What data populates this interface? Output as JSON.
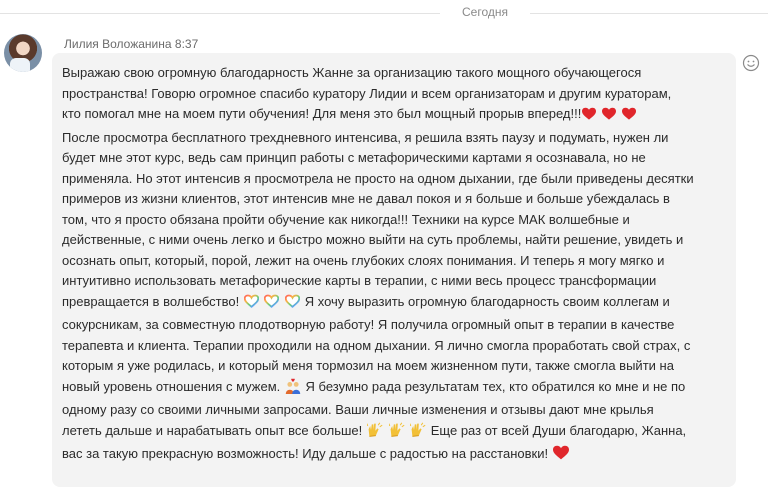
{
  "date_separator": "Сегодня",
  "message": {
    "sender": "Лилия Воложанина",
    "time": "8:37",
    "lines": [
      "Выражаю свою огромную благодарность Жанне за организацию такого мощного обучающегося",
      "пространства! Говорю огромное спасибо куратору Лидии и всем организаторам и другим кураторам,",
      "кто помогал мне на моем пути обучения! Для меня это был мощный прорыв вперед!!!",
      "После просмотра бесплатного трехдневного интенсива,  я решила взять паузу и подумать, нужен ли",
      "будет мне этот курс, ведь сам принцип работы с метафорическими картами я осознавала, но не",
      "применяла. Но этот интенсив я просмотрела не просто на одном дыхании, где были приведены десятки",
      "примеров из жизни клиентов, этот интенсив мне не давал покоя и я больше и больше убеждалась в",
      "том, что я просто обязана пройти обучение как никогда!!! Техники на курсе МАК волшебные и",
      "действенные, с ними очень легко и быстро можно выйти на суть проблемы, найти решение, увидеть и",
      "осознать опыт, который, порой, лежит на очень глубоких слоях понимания. И теперь я могу мягко и",
      "интуитивно использовать метафорические карты в терапии, с ними весь процесс трансформации",
      "превращается в волшебство!",
      "Я хочу  выразить огромную благодарность своим коллегам и",
      "сокурсникам, за совместную плодотворную работу! Я получила огромный опыт в терапии в качестве",
      "терапевта и клиента. Терапии проходили на одном дыхании. Я лично смогла проработать свой страх, с",
      "которым я уже родилась, и который меня тормозил на моем жизненном пути, также смогла выйти на",
      "новый уровень отношения с мужем.",
      "Я безумно рада результатам тех, кто обратился ко мне и не по",
      "одному разу со своими личными запросами. Ваши личные  изменения и отзывы дают мне крылья",
      "лететь дальше и нарабатывать опыт все больше!",
      "Еще раз от всей Души благодарю, Жанна,",
      "вас за такую прекрасную возможность! Иду дальше с радостью на расстановки!"
    ],
    "emoji": {
      "heart": "red-heart-icon",
      "rainbow_heart": "rainbow-heart-icon",
      "couple": "couple-with-heart-icon",
      "hands": "raising-hands-icon"
    }
  },
  "reaction_icon": "smiley-reaction-icon",
  "colors": {
    "heart": "#e0262b",
    "bubble": "#f3f3f3",
    "hands": "#f2c037"
  }
}
